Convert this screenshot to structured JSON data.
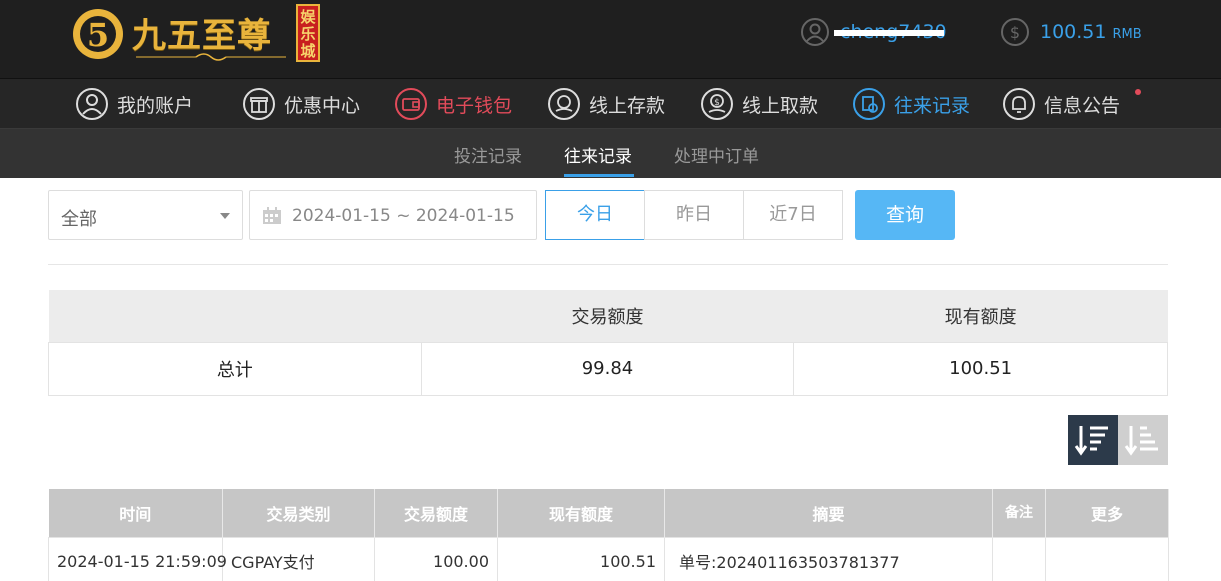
{
  "header": {
    "logo_text": "九五至尊",
    "logo_sub": "娱乐城",
    "username": "cheng7430",
    "balance": "100.51",
    "currency": "RMB"
  },
  "nav": {
    "items": [
      {
        "label": "我的账户",
        "icon": "user-icon"
      },
      {
        "label": "优惠中心",
        "icon": "gift-icon"
      },
      {
        "label": "电子钱包",
        "icon": "wallet-icon"
      },
      {
        "label": "线上存款",
        "icon": "deposit-icon"
      },
      {
        "label": "线上取款",
        "icon": "withdraw-icon"
      },
      {
        "label": "往来记录",
        "icon": "record-icon"
      },
      {
        "label": "信息公告",
        "icon": "bell-icon"
      }
    ]
  },
  "subnav": {
    "items": [
      "投注记录",
      "往来记录",
      "处理中订单"
    ],
    "active": "往来记录"
  },
  "filters": {
    "type_value": "全部",
    "date_range": "2024-01-15 ~ 2024-01-15",
    "date_options": [
      "今日",
      "昨日",
      "近7日"
    ],
    "query_label": "查询"
  },
  "summary": {
    "headers": [
      "",
      "交易额度",
      "现有额度"
    ],
    "total_label": "总计",
    "total_amount": "99.84",
    "current_amount": "100.51"
  },
  "table": {
    "headers": [
      "时间",
      "交易类别",
      "交易额度",
      "现有额度",
      "摘要",
      "备注",
      "更多"
    ],
    "rows": [
      {
        "time": "2024-01-15 21:59:09",
        "type": "CGPAY支付",
        "amount": "100.00",
        "balance": "100.51",
        "summary": "单号:202401163503781377",
        "note": "",
        "more": ""
      }
    ]
  },
  "colors": {
    "accent": "#3aa0e8",
    "highlight_red": "#e24b5a",
    "header_bg": "#1f1f1f",
    "query_button": "#56b7f5"
  }
}
